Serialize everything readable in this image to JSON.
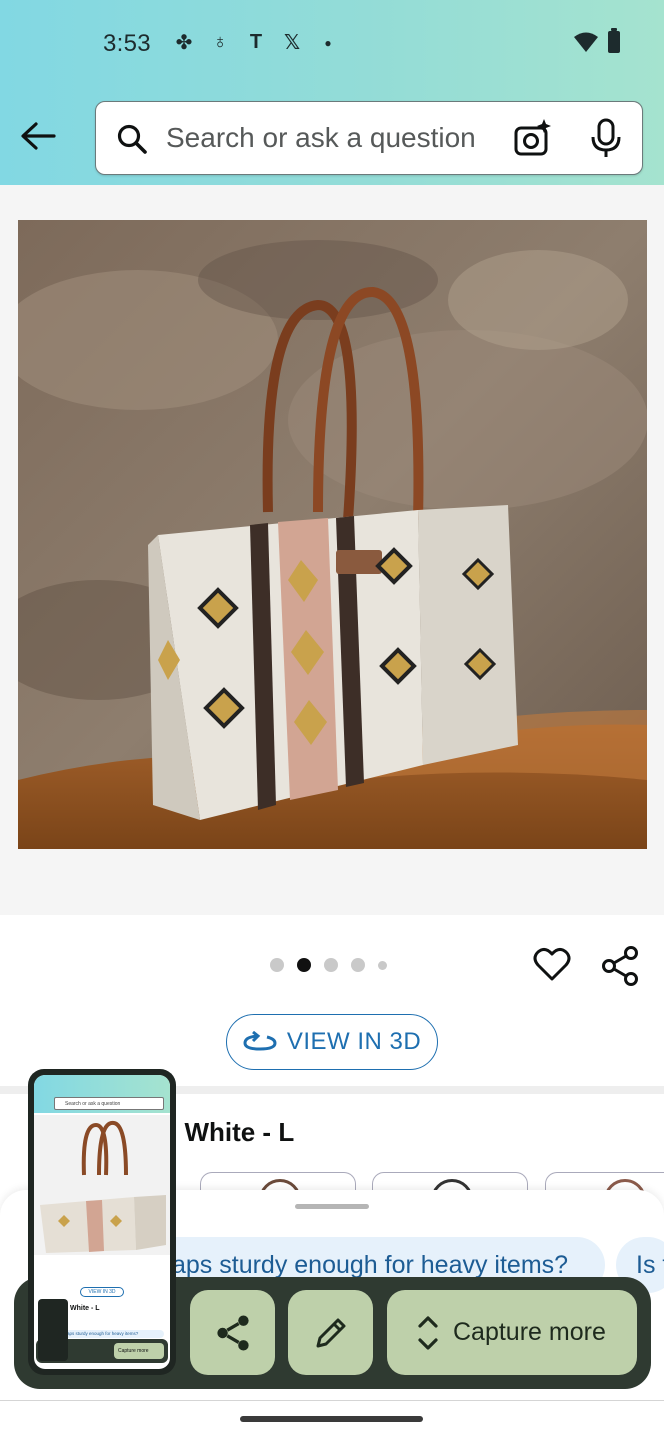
{
  "status_bar": {
    "time": "3:53",
    "left_icons": [
      "pinwheel-icon",
      "water-drop-icon",
      "tesla-icon",
      "x-icon",
      "dot-icon"
    ],
    "right_icons": [
      "wifi-icon",
      "battery-icon"
    ]
  },
  "header": {
    "search_placeholder": "Search or ask a question",
    "colors": {
      "gradient_start": "#82d8e3",
      "gradient_end": "#a5e3cf"
    }
  },
  "product": {
    "image_description_icon": "product-photo",
    "carousel": {
      "count": 5,
      "active_index": 1
    },
    "view_3d_label": "VIEW IN 3D",
    "title_visible_fragment": "l White - L"
  },
  "suggestions": {
    "chips": [
      "aps sturdy enough for heavy items?",
      "Is t"
    ]
  },
  "screenshot_toolbar": {
    "capture_more_label": "Capture more",
    "buttons": [
      "share-icon",
      "edit-icon",
      "expand-icon"
    ]
  },
  "thumbnail": {
    "search_text": "Search or ask a question",
    "view_3d": "VIEW IN 3D",
    "title": "White - L",
    "chip": "aps sturdy enough for heavy items?",
    "capture": "Capture more"
  }
}
